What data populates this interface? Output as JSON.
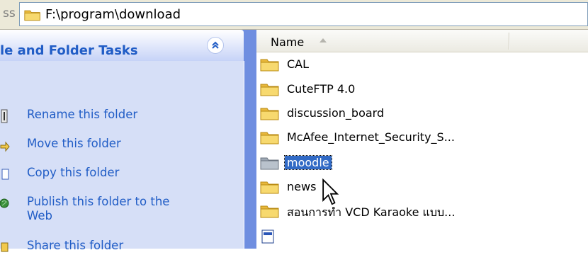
{
  "address_bar": {
    "label_fragment": "ss",
    "path": "F:\\program\\download"
  },
  "task_pane": {
    "title": "le and Folder Tasks",
    "items": [
      {
        "label": "Rename this folder",
        "icon": "rename-icon"
      },
      {
        "label": "Move this folder",
        "icon": "move-icon"
      },
      {
        "label": "Copy this folder",
        "icon": "copy-icon"
      },
      {
        "label": "Publish this folder to the",
        "label2": "Web",
        "icon": "publish-icon"
      },
      {
        "label": "Share this folder",
        "icon": "share-icon"
      }
    ]
  },
  "file_list": {
    "column_name": "Name",
    "sort": "ascending",
    "rows": [
      {
        "name": "CAL",
        "type": "folder"
      },
      {
        "name": "CuteFTP 4.0",
        "type": "folder"
      },
      {
        "name": "discussion_board",
        "type": "folder"
      },
      {
        "name": "McAfee_Internet_Security_S...",
        "type": "folder"
      },
      {
        "name": "moodle",
        "type": "folder",
        "selected": true
      },
      {
        "name": "news",
        "type": "folder"
      },
      {
        "name": "สอนการทำ VCD Karaoke แบบ...",
        "type": "folder"
      },
      {
        "name": "",
        "type": "file"
      }
    ]
  },
  "colors": {
    "selection": "#316ac5",
    "task_link": "#215dc6",
    "task_bg": "#d6dff7",
    "folder_yellow": "#f5d36a"
  }
}
